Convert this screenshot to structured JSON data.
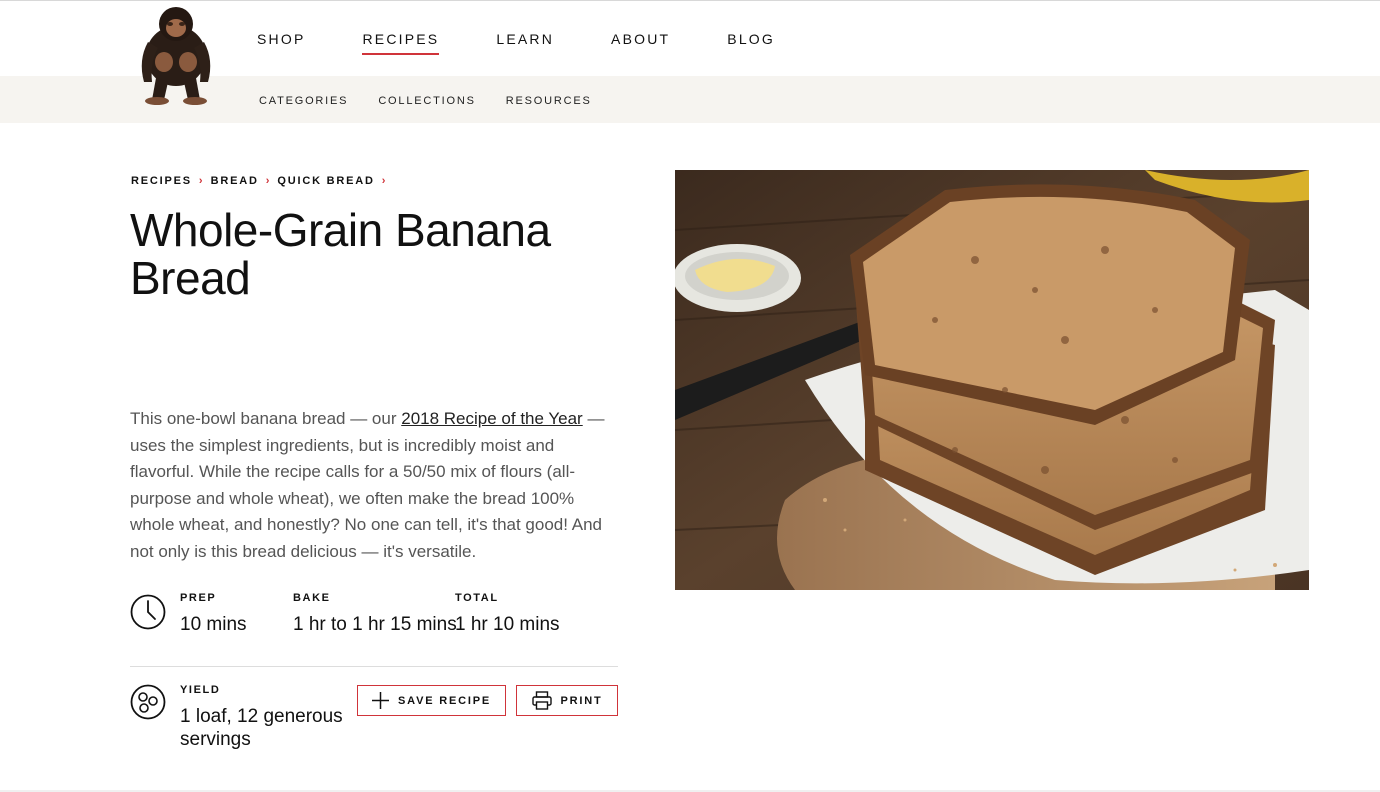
{
  "nav": {
    "primary": [
      "SHOP",
      "RECIPES",
      "LEARN",
      "ABOUT",
      "BLOG"
    ],
    "active": "RECIPES",
    "secondary": [
      "CATEGORIES",
      "COLLECTIONS",
      "RESOURCES"
    ]
  },
  "breadcrumb": [
    "RECIPES",
    "BREAD",
    "QUICK BREAD"
  ],
  "recipe": {
    "title": "Whole-Grain Banana Bread",
    "intro_before": "This one-bowl banana bread — our ",
    "intro_link": "2018 Recipe of the Year",
    "intro_after": " — uses the simplest ingredients, but is incredibly moist and flavorful. While the recipe calls for a 50/50 mix of flours (all-purpose and whole wheat), we often make the bread 100% whole wheat, and honestly? No one can tell, it's that good! And not only is this bread delicious — it's versatile.",
    "prep_label": "PREP",
    "prep_value": "10 mins",
    "bake_label": "BAKE",
    "bake_value": "1 hr to 1 hr 15 mins",
    "total_label": "TOTAL",
    "total_value": "1 hr 10 mins",
    "yield_label": "YIELD",
    "yield_value": "1 loaf, 12 generous servings"
  },
  "actions": {
    "save_label": "SAVE RECIPE",
    "print_label": "PRINT"
  },
  "colors": {
    "accent": "#d0343a",
    "subnav_bg": "#f6f4f0"
  },
  "icons": [
    "chimp-logo-icon",
    "chevron-right-icon",
    "clock-icon",
    "yield-icon",
    "plus-icon",
    "printer-icon"
  ]
}
